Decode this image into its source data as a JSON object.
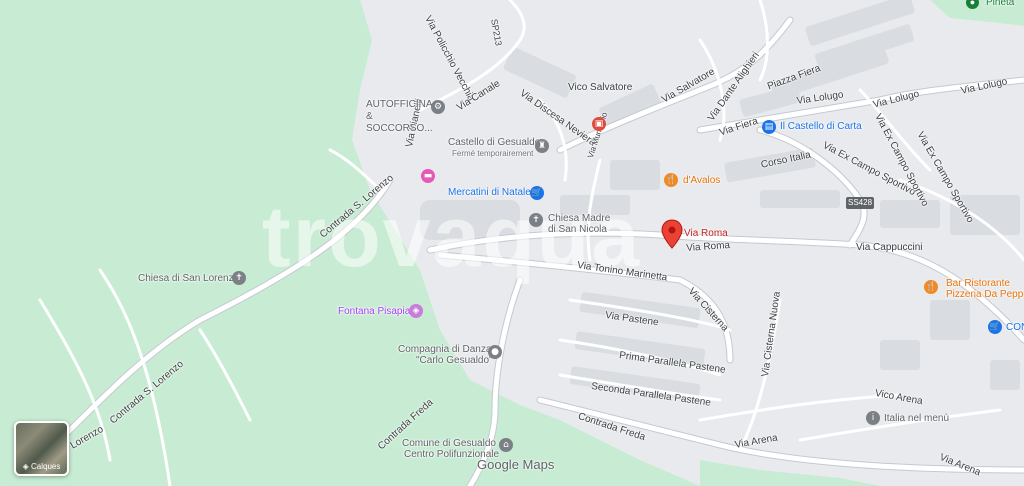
{
  "colors": {
    "park": "#c8ecd3",
    "urban": "#e8eaed",
    "block": "#d9dce1",
    "road": "#ffffff",
    "road_outline": "#c4c9d1",
    "main_road": "#ffffff",
    "pin_red": "#ea4335"
  },
  "watermark": "trovaqua",
  "map": {
    "selected_place": "Via Roma",
    "streets": {
      "via_policchio_vecchia": "Via Policchio Vecchia",
      "sp213": "SP213",
      "via_canale": "Via Canale",
      "vico_salvatore": "Vico Salvatore",
      "via_discesa_neviera": "Via Discesa Neviera",
      "via_salvatore": "Via Salvatore",
      "via_dante_alighieri": "Via Dante Alighieri",
      "piazza_fiera": "Piazza Fiera",
      "via_lolugo_1": "Via Lolugo",
      "via_lolugo_2": "Via Lolugo",
      "via_lolugo_3": "Via Lolugo",
      "via_fiera": "Via Fiera",
      "via_ex_campo_sportivo": "Via Ex Campo Sportivo",
      "via_ex_campo_sportivo_2": "Via Ex Campo Sportivo",
      "via_ex_campo_sportivo_3": "Via Ex Campo Sportivo",
      "corso_italia": "Corso Italia",
      "ss428": "SS428",
      "via_pianelli": "Via Pianelli",
      "via_municipio": "Via Municipio",
      "contrada_s_lorenzo_1": "Contrada S. Lorenzo",
      "contrada_s_lorenzo_2": "Contrada S. Lorenzo",
      "contrada_s_lorenzo_3": "Contrada S. Lorenzo",
      "via_roma": "Via Roma",
      "via_cappuccini": "Via Cappuccini",
      "via_tonino_marinetta": "Via Tonino Marinetta",
      "via_cisterna": "Via Cisterna",
      "via_pastene": "Via Pastene",
      "prima_parallela_pastene": "Prima Parallela Pastene",
      "seconda_parallela_pastene": "Seconda Parallela Pastene",
      "via_cisterna_nuova": "Via Cisterna Nuova",
      "vico_arena": "Vico Arena",
      "via_arena_1": "Via Arena",
      "via_arena_2": "Via Arena",
      "contrada_freda_1": "Contrada Freda",
      "contrada_freda_2": "Contrada Freda"
    },
    "pois": {
      "pineta": "Pineta",
      "autofficina": "AUTOFFICINA & SOCCORSO...",
      "castello_di_gesualdo": "Castello di Gesualdo",
      "castello_note": "Fermé temporairement",
      "il_castello_di_carta": "Il Castello di Carta",
      "mercatini_di_natale": "Mercatini di Natale",
      "davalos": "d'Avalos",
      "chiesa_madre_1": "Chiesa Madre",
      "chiesa_madre_2": "di San Nicola",
      "chiesa_di_san_lorenzo": "Chiesa di San Lorenzo",
      "fontana_pisapia": "Fontana Pisapia",
      "compagnia_danza_1": "Compagnia di Danza",
      "compagnia_danza_2": "\"Carlo Gesualdo\"",
      "bar_ristorante_1": "Bar Ristorante",
      "bar_ristorante_2": "Pizzeria Da Peppino",
      "con": "CON",
      "italia_nel_menu": "Italia nel menù",
      "comune_1": "Comune di Gesualdo",
      "comune_2": "Centro Polifunzionale"
    }
  },
  "controls": {
    "layers_label": "Calques",
    "google_logo_1": "Google",
    "google_logo_2": "Maps"
  }
}
